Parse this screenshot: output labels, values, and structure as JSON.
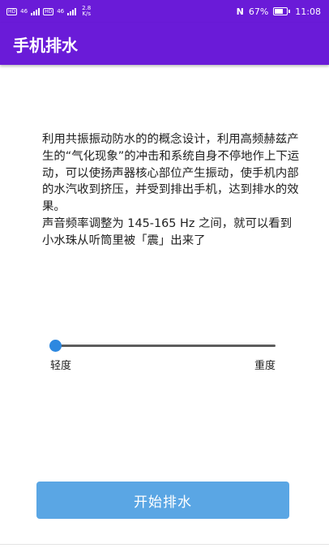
{
  "status_bar": {
    "network_speed_value": "2.8",
    "network_speed_unit": "K/s",
    "signal_1_label": "46",
    "signal_2_label": "46",
    "nfc_label": "N",
    "battery_percent": "67%",
    "battery_level": 0.67,
    "time": "11:08"
  },
  "app_bar": {
    "title": "手机排水"
  },
  "main": {
    "description": "利用共振振动防水的的概念设计，利用高频赫兹产生的“气化现象”的冲击和系统自身不停地作上下运动，可以使扬声器核心部位产生振动，使手机内部的水汽收到挤压，并受到排出手机，达到排水的效果。\n 声音频率调整为 145-165 Hz 之间，就可以看到小水珠从听筒里被「震」出来了",
    "slider": {
      "value": 0,
      "min_label": "轻度",
      "max_label": "重度"
    },
    "start_button_label": "开始排水"
  },
  "colors": {
    "primary": "#6a1bd8",
    "button": "#5aa6e4",
    "slider_thumb": "#2d88e0"
  }
}
